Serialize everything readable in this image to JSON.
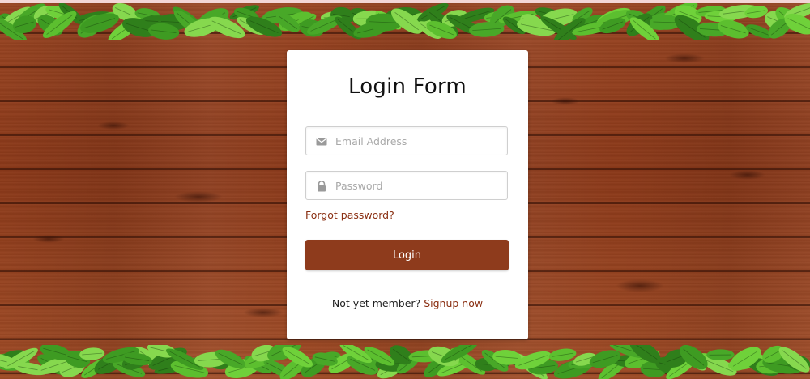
{
  "login_form": {
    "title": "Login Form",
    "email": {
      "placeholder": "Email Address",
      "value": "",
      "icon": "envelope-icon"
    },
    "password": {
      "placeholder": "Password",
      "value": "",
      "icon": "lock-icon"
    },
    "forgot_password_label": "Forgot password?",
    "login_button_label": "Login",
    "signup_prompt": "Not yet member?",
    "signup_link_label": "Signup now"
  },
  "colors": {
    "accent": "#8e3b1c",
    "link": "#8a2f12",
    "wood": "#8b3818",
    "leaf": "#4caf2a"
  }
}
